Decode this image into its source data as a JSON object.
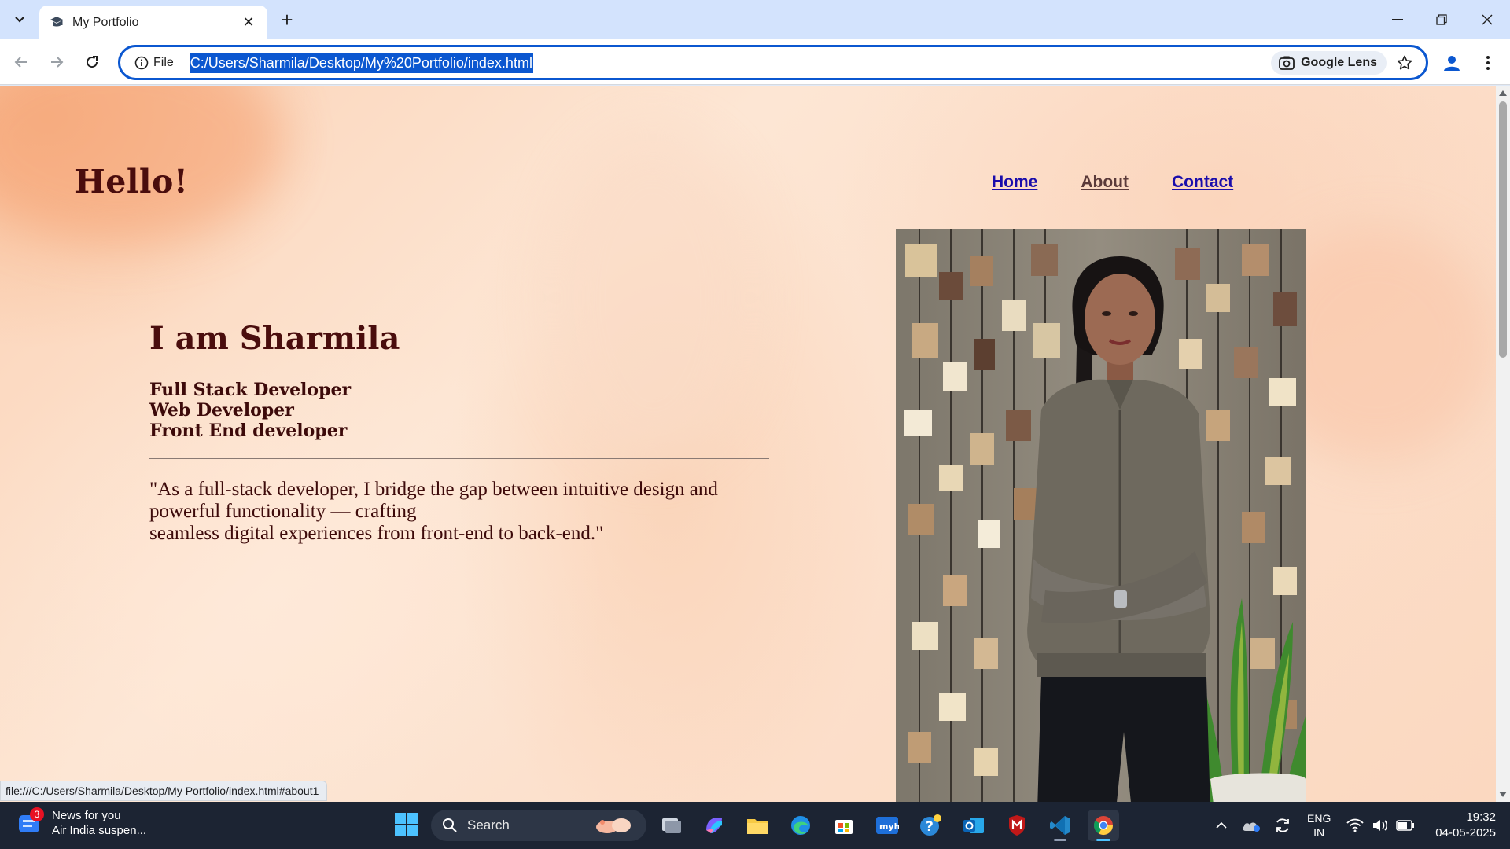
{
  "browser": {
    "tab": {
      "title": "My Portfolio"
    },
    "address": {
      "chip_label": "File",
      "url": "C:/Users/Sharmila/Desktop/My%20Portfolio/index.html"
    },
    "lens_label": "Google Lens",
    "status_url": "file:///C:/Users/Sharmila/Desktop/My Portfolio/index.html#about1",
    "accent": "#0b57d0"
  },
  "page": {
    "greeting": "Hello!",
    "nav": {
      "home": "Home",
      "about": "About",
      "contact": "Contact"
    },
    "heading": "I am Sharmila",
    "roles": [
      "Full Stack Developer",
      "Web Developer",
      "Front End developer"
    ],
    "quote_line1": "\"As a full-stack developer, I bridge the gap between intuitive design and",
    "quote_line2": "powerful functionality — crafting",
    "quote_line3": "seamless digital experiences from front-end to back-end.\"",
    "colors": {
      "heading": "#4a0d0d",
      "link": "#1a0dab"
    }
  },
  "taskbar": {
    "news": {
      "badge": "3",
      "title": "News for you",
      "subtitle": "Air India suspen..."
    },
    "search_label": "Search",
    "lang": {
      "line1": "ENG",
      "line2": "IN"
    },
    "clock": {
      "time": "19:32",
      "date": "04-05-2025"
    }
  }
}
